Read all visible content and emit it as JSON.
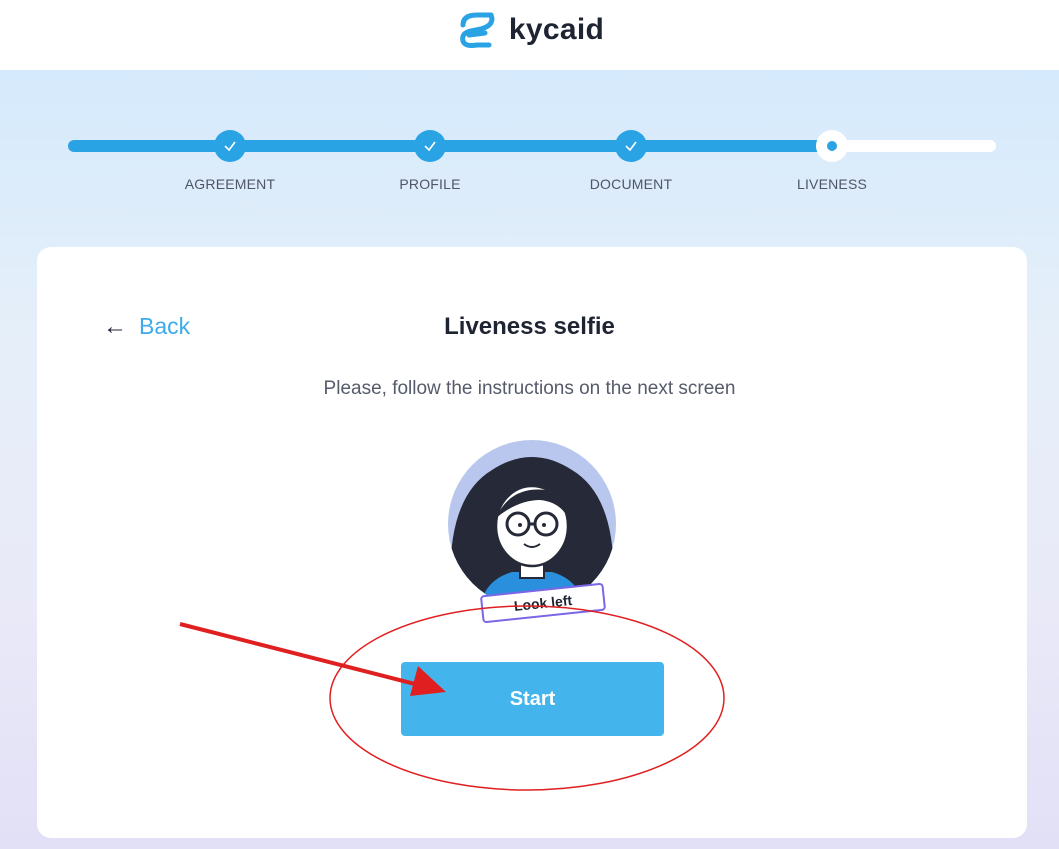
{
  "header": {
    "logo_text": "kycaid",
    "logo_icon": "kycaid-swirl-icon"
  },
  "steps": [
    {
      "label": "AGREEMENT",
      "status": "done"
    },
    {
      "label": "PROFILE",
      "status": "done"
    },
    {
      "label": "DOCUMENT",
      "status": "done"
    },
    {
      "label": "LIVENESS",
      "status": "current"
    }
  ],
  "card": {
    "back_label": "Back",
    "title": "Liveness selfie",
    "subtitle": "Please, follow the instructions on the next screen",
    "illustration_caption": "Look left",
    "start_label": "Start"
  },
  "colors": {
    "accent": "#2aa3e4",
    "button": "#43b4ec",
    "annotation": "#e02020"
  }
}
